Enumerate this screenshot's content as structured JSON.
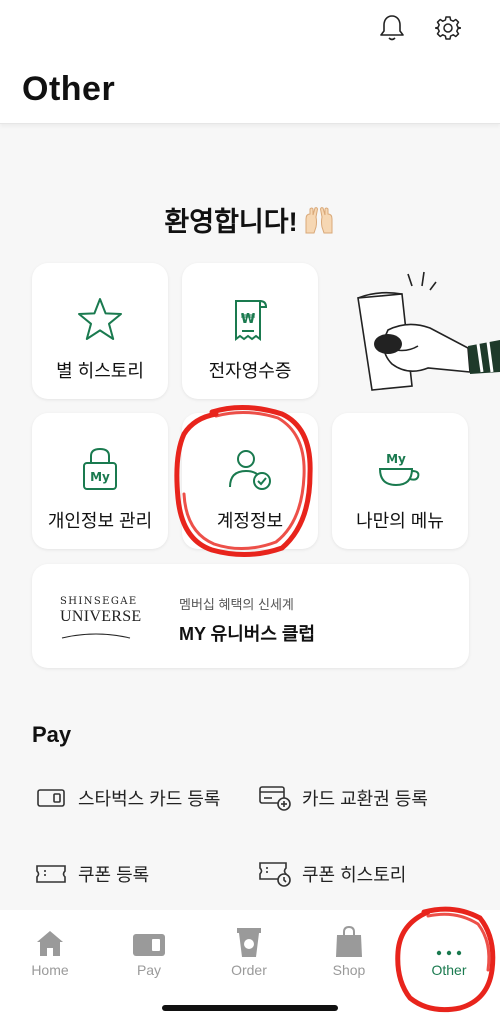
{
  "header": {
    "title": "Other",
    "bell_icon": "bell-icon",
    "settings_icon": "gear-icon"
  },
  "welcome": {
    "text": "환영합니다!",
    "emoji": "🙌"
  },
  "tiles": [
    {
      "label": "별 히스토리",
      "icon": "star-icon"
    },
    {
      "label": "전자영수증",
      "icon": "receipt-icon"
    },
    {
      "label": "개인정보 관리",
      "icon": "lock-my-icon"
    },
    {
      "label": "계정정보",
      "icon": "account-check-icon"
    },
    {
      "label": "나만의 메뉴",
      "icon": "my-cup-icon"
    }
  ],
  "universe": {
    "logo_line1": "SHINSEGAE",
    "logo_line2": "UNIVERSE",
    "subtitle": "멤버십 혜택의 신세계",
    "title": "MY 유니버스 클럽"
  },
  "pay": {
    "section_title": "Pay",
    "items": [
      {
        "label": "스타벅스 카드 등록",
        "icon": "card-icon"
      },
      {
        "label": "카드 교환권 등록",
        "icon": "card-add-icon"
      },
      {
        "label": "쿠폰 등록",
        "icon": "coupon-icon"
      },
      {
        "label": "쿠폰 히스토리",
        "icon": "coupon-history-icon"
      }
    ]
  },
  "tabbar": {
    "items": [
      {
        "label": "Home",
        "icon": "home-icon"
      },
      {
        "label": "Pay",
        "icon": "pay-card-icon"
      },
      {
        "label": "Order",
        "icon": "cup-icon"
      },
      {
        "label": "Shop",
        "icon": "shopping-bag-icon"
      },
      {
        "label": "Other",
        "icon": "more-dots-icon"
      }
    ],
    "active": "Other"
  },
  "colors": {
    "brand_green": "#1a7a4f",
    "annotation_red": "#e8241c",
    "inactive_gray": "#9a9a9a"
  }
}
